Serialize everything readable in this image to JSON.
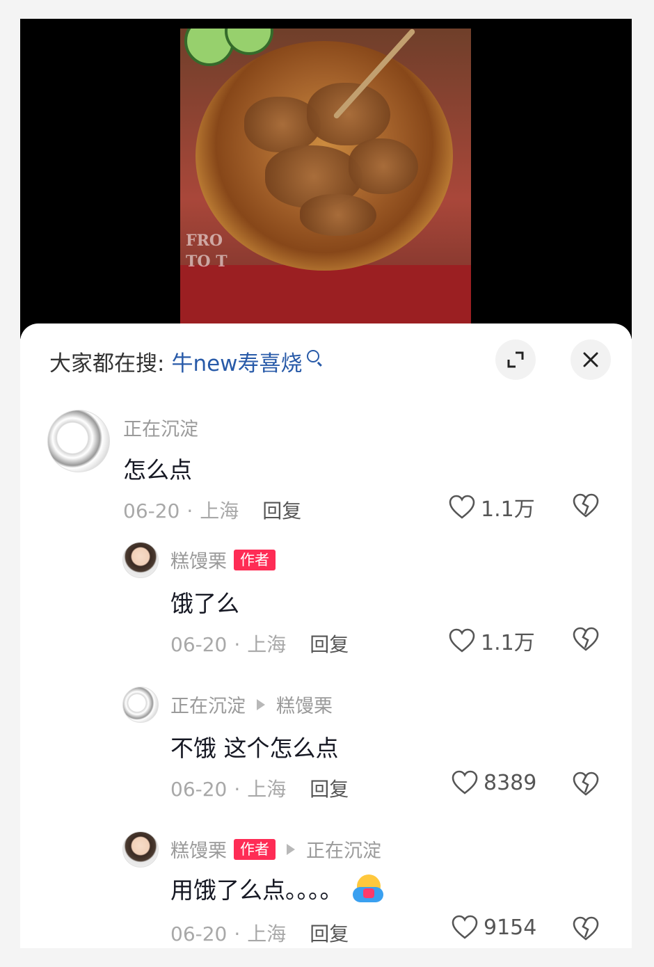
{
  "video": {
    "watermark_lines": [
      "FRO",
      "TO T"
    ]
  },
  "panel": {
    "search_label": "大家都在搜:",
    "search_term": "牛new寿喜烧"
  },
  "comments": [
    {
      "name": "正在沉淀",
      "text": "怎么点",
      "date": "06-20",
      "dot": "·",
      "location": "上海",
      "reply": "回复",
      "likes": "1.1万"
    },
    {
      "name": "糕馒栗",
      "badge": "作者",
      "text": "饿了么",
      "date": "06-20",
      "dot": "·",
      "location": "上海",
      "reply": "回复",
      "likes": "1.1万"
    },
    {
      "name": "正在沉淀",
      "reply_to": "糕馒栗",
      "text": "不饿 这个怎么点",
      "date": "06-20",
      "dot": "·",
      "location": "上海",
      "reply": "回复",
      "likes": "8389"
    },
    {
      "name": "糕馒栗",
      "badge": "作者",
      "reply_to": "正在沉淀",
      "text": "用饿了么点。。。。",
      "emoji": "hug-face-emoji",
      "date": "06-20",
      "dot": "·",
      "location": "上海",
      "reply": "回复",
      "likes": "9154"
    }
  ],
  "colors": {
    "accent": "#fe2c55",
    "link": "#285aa8",
    "muted": "#9a9a9a"
  }
}
